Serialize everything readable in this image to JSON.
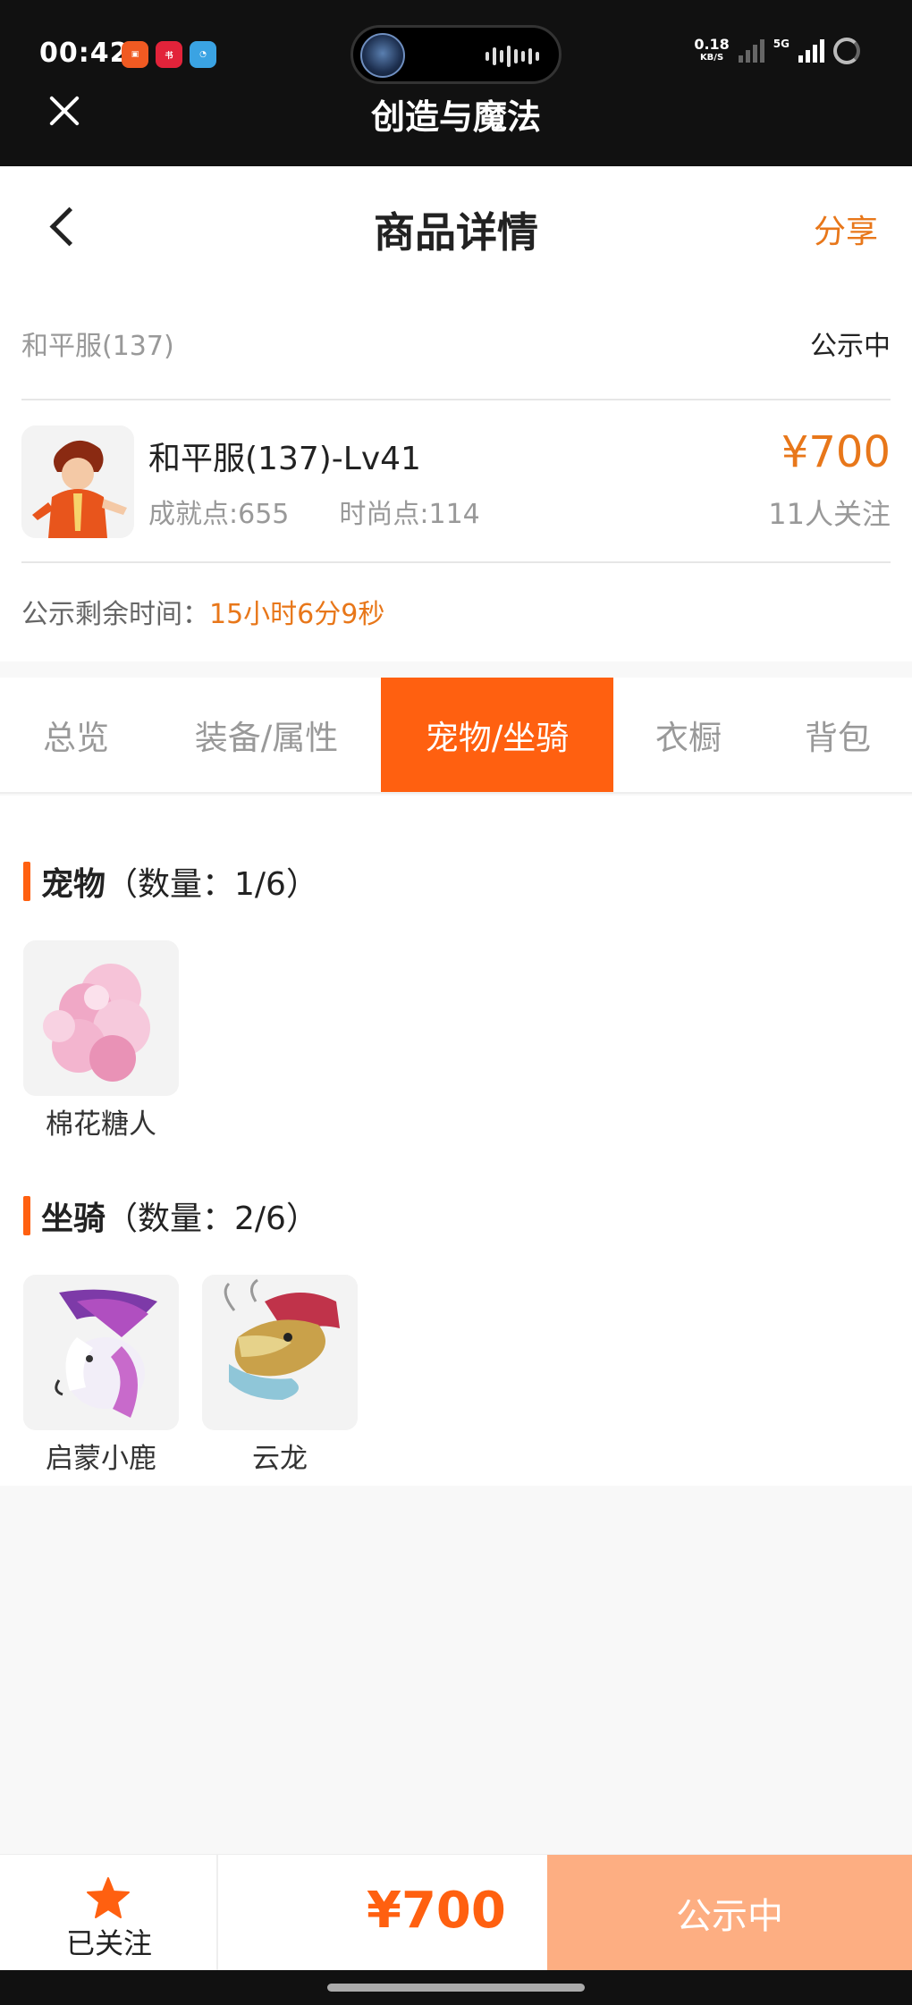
{
  "status_bar": {
    "time": "00:42",
    "net_speed_value": "0.18",
    "net_speed_unit": "KB/S",
    "network_type": "5G",
    "app_title": "创造与魔法"
  },
  "header": {
    "title": "商品详情",
    "share_label": "分享"
  },
  "listing": {
    "server": "和平服(137)",
    "status": "公示中",
    "character_title": "和平服(137)-Lv41",
    "achievement": "成就点:655",
    "fashion": "时尚点:114",
    "price": "¥700",
    "followers": "11人关注",
    "countdown_label": "公示剩余时间：",
    "countdown_value": "15小时6分9秒"
  },
  "tabs": [
    {
      "label": "总览"
    },
    {
      "label": "装备/属性"
    },
    {
      "label": "宠物/坐骑"
    },
    {
      "label": "衣橱"
    },
    {
      "label": "背包"
    }
  ],
  "active_tab_index": 2,
  "pets": {
    "title": "宠物",
    "count": "（数量：1/6）",
    "items": [
      {
        "label": "棉花糖人"
      }
    ]
  },
  "mounts": {
    "title": "坐骑",
    "count": "（数量：2/6）",
    "items": [
      {
        "label": "启蒙小鹿"
      },
      {
        "label": "云龙"
      }
    ]
  },
  "bottom_bar": {
    "follow_label": "已关注",
    "price": "¥700",
    "action_label": "公示中"
  },
  "colors": {
    "accent": "#ff6010",
    "price_orange": "#e8771a",
    "action_button": "#fdae82"
  }
}
